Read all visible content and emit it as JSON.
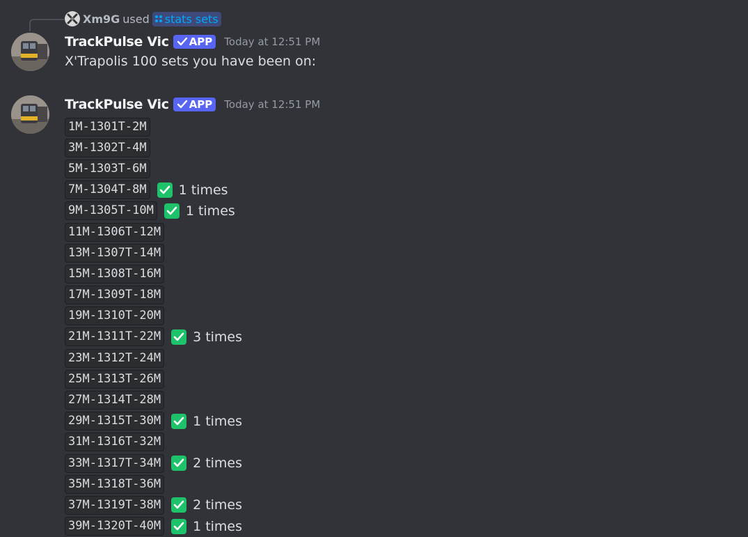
{
  "reply": {
    "user": "Xm9G",
    "used": "used",
    "command": "stats sets"
  },
  "messages": [
    {
      "username": "TrackPulse Vic",
      "badge": "APP",
      "timestamp": "Today at 12:51 PM",
      "text": "X'Trapolis 100 sets you have been on:"
    },
    {
      "username": "TrackPulse Vic",
      "badge": "APP",
      "timestamp": "Today at 12:51 PM"
    }
  ],
  "sets": [
    {
      "code": "1M-1301T-2M",
      "times": ""
    },
    {
      "code": "3M-1302T-4M",
      "times": ""
    },
    {
      "code": "5M-1303T-6M",
      "times": ""
    },
    {
      "code": "7M-1304T-8M",
      "times": "1 times"
    },
    {
      "code": "9M-1305T-10M",
      "times": "1 times"
    },
    {
      "code": "11M-1306T-12M",
      "times": ""
    },
    {
      "code": "13M-1307T-14M",
      "times": ""
    },
    {
      "code": "15M-1308T-16M",
      "times": ""
    },
    {
      "code": "17M-1309T-18M",
      "times": ""
    },
    {
      "code": "19M-1310T-20M",
      "times": ""
    },
    {
      "code": "21M-1311T-22M",
      "times": "3 times"
    },
    {
      "code": "23M-1312T-24M",
      "times": ""
    },
    {
      "code": "25M-1313T-26M",
      "times": ""
    },
    {
      "code": "27M-1314T-28M",
      "times": ""
    },
    {
      "code": "29M-1315T-30M",
      "times": "1 times"
    },
    {
      "code": "31M-1316T-32M",
      "times": ""
    },
    {
      "code": "33M-1317T-34M",
      "times": "2 times"
    },
    {
      "code": "35M-1318T-36M",
      "times": ""
    },
    {
      "code": "37M-1319T-38M",
      "times": "2 times"
    },
    {
      "code": "39M-1320T-40M",
      "times": "1 times"
    }
  ],
  "icons": {
    "check": "white-check-mark-icon",
    "command": "slash-command-icon",
    "verified": "verified-check-icon"
  },
  "colors": {
    "background": "#313338",
    "accent": "#5865f2",
    "check": "#1ec26a",
    "command": "#00a8fc"
  }
}
